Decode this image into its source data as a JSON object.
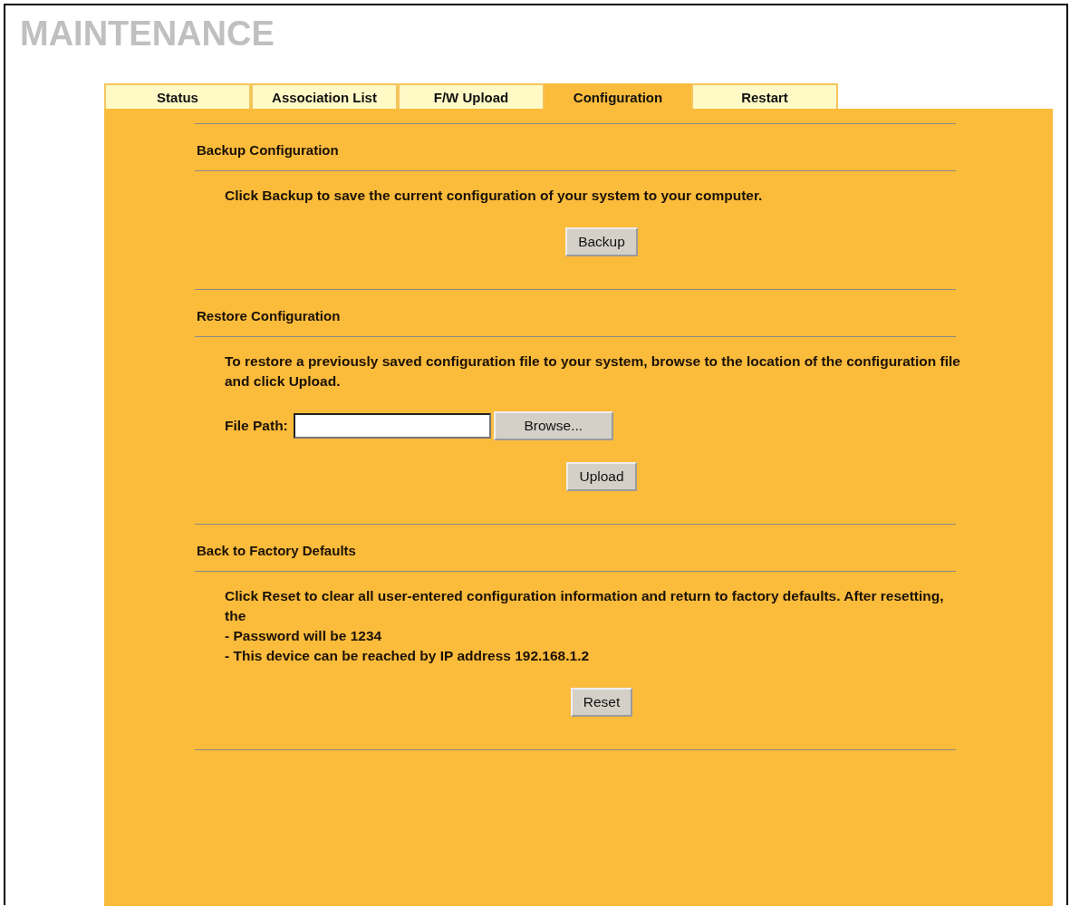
{
  "title": "MAINTENANCE",
  "tabs": [
    {
      "label": "Status",
      "selected": false
    },
    {
      "label": "Association List",
      "selected": false
    },
    {
      "label": "F/W Upload",
      "selected": false
    },
    {
      "label": "Configuration",
      "selected": true
    },
    {
      "label": "Restart",
      "selected": false
    }
  ],
  "sections": [
    {
      "heading": "Backup Configuration",
      "items": [
        {
          "kind": "text",
          "text": "Click Backup to save the current configuration of your system to your computer."
        },
        {
          "kind": "button",
          "label": "Backup"
        }
      ]
    },
    {
      "heading": "Restore Configuration",
      "items": [
        {
          "kind": "text",
          "text": "To restore a previously saved configuration file to your system, browse to the location of the configuration file and click Upload."
        },
        {
          "kind": "file",
          "label": "File Path:",
          "button": "Browse..."
        },
        {
          "kind": "button",
          "label": "Upload"
        }
      ]
    },
    {
      "heading": "Back to Factory Defaults",
      "items": [
        {
          "kind": "text",
          "text": "Click Reset to clear all user-entered configuration information and return to factory defaults. After resetting, the"
        },
        {
          "kind": "line",
          "text": "- Password will be 1234"
        },
        {
          "kind": "line",
          "text": "- This device can be reached by IP address 192.168.1.2"
        },
        {
          "kind": "button",
          "label": "Reset"
        }
      ]
    }
  ]
}
